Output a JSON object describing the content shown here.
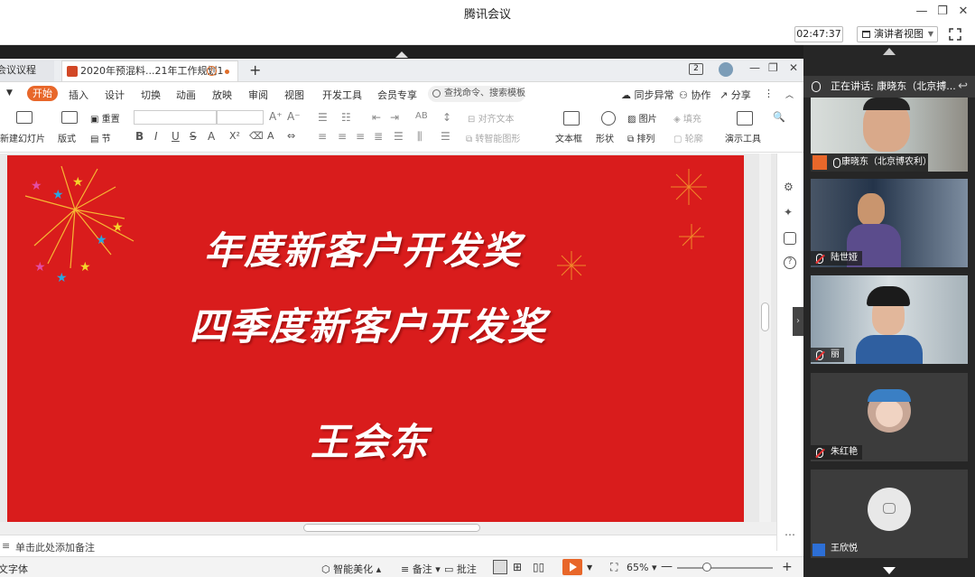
{
  "window": {
    "title": "腾讯会议"
  },
  "meeting_bar": {
    "timer": "02:47:37",
    "presenter_view": "演讲者视图"
  },
  "wps": {
    "tabs": [
      {
        "label": "会议议程"
      },
      {
        "label": "2020年预混料...21年工作规划1"
      }
    ],
    "tab_badge": "2",
    "menus": [
      "开始",
      "插入",
      "设计",
      "切换",
      "动画",
      "放映",
      "审阅",
      "视图",
      "开发工具",
      "会员专享"
    ],
    "search_placeholder": "查找命令、搜索模板",
    "right_menus": [
      "同步异常",
      "协作",
      "分享"
    ],
    "toolbar": {
      "new_slide": "新建幻灯片",
      "layout": "版式",
      "reset": "重置",
      "section": "节",
      "align_text": "对齐文本",
      "smart_shape": "转智能图形",
      "textbox": "文本框",
      "shape": "形状",
      "picture": "图片",
      "fill": "填充",
      "arrange": "排列",
      "outline": "轮廓",
      "presenter_tools": "演示工具"
    },
    "slide": {
      "line1": "年度新客户开发奖",
      "line2": "四季度新客户开发奖",
      "line3": "王会东"
    },
    "notes_placeholder": "单击此处添加备注",
    "status": {
      "font": "文字体",
      "beautify": "智能美化",
      "notes": "备注",
      "comments": "批注",
      "zoom": "65%"
    }
  },
  "participants": {
    "speaking": "正在讲话: 康晓东（北京搏...",
    "list": [
      {
        "name": "康晓东（北京博农利）"
      },
      {
        "name": "陆世娅"
      },
      {
        "name": "丽"
      },
      {
        "name": "朱红艳"
      },
      {
        "name": "王欣悦"
      }
    ]
  },
  "colors": {
    "slide_red": "#d91c1c",
    "wps_accent": "#e8672a",
    "panel_bg": "#262626"
  }
}
